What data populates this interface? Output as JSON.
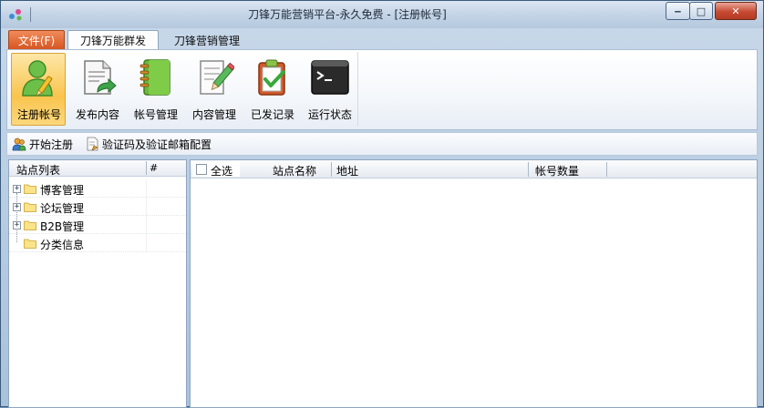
{
  "window": {
    "title": "刀锋万能营销平台-永久免费 - [注册帐号]",
    "controls": {
      "minimize": "‒",
      "maximize": "□",
      "close": "✕"
    }
  },
  "tabs": {
    "file": "文件(F)",
    "items": [
      {
        "label": "刀锋万能群发",
        "active": true
      },
      {
        "label": "刀锋营销管理",
        "active": false
      }
    ]
  },
  "ribbon": {
    "buttons": [
      {
        "label": "注册帐号",
        "icon": "user-register-icon",
        "selected": true
      },
      {
        "label": "发布内容",
        "icon": "publish-document-icon",
        "selected": false
      },
      {
        "label": "帐号管理",
        "icon": "address-book-icon",
        "selected": false
      },
      {
        "label": "内容管理",
        "icon": "edit-document-icon",
        "selected": false
      },
      {
        "label": "已发记录",
        "icon": "clipboard-check-icon",
        "selected": false
      },
      {
        "label": "运行状态",
        "icon": "terminal-icon",
        "selected": false
      }
    ]
  },
  "toolbar": {
    "start_register": "开始注册",
    "captcha_config": "验证码及验证邮箱配置"
  },
  "site_list": {
    "header": "站点列表",
    "count_header": "#",
    "items": [
      {
        "label": "博客管理",
        "expandable": true
      },
      {
        "label": "论坛管理",
        "expandable": true
      },
      {
        "label": "B2B管理",
        "expandable": true
      },
      {
        "label": "分类信息",
        "expandable": false
      }
    ]
  },
  "grid": {
    "select_all": "全选",
    "columns": [
      "站点名称",
      "地址",
      "帐号数量"
    ]
  },
  "colors": {
    "file_tab": "#d6531e",
    "selected_button": "#f9c44e",
    "close_button": "#c74a32"
  }
}
